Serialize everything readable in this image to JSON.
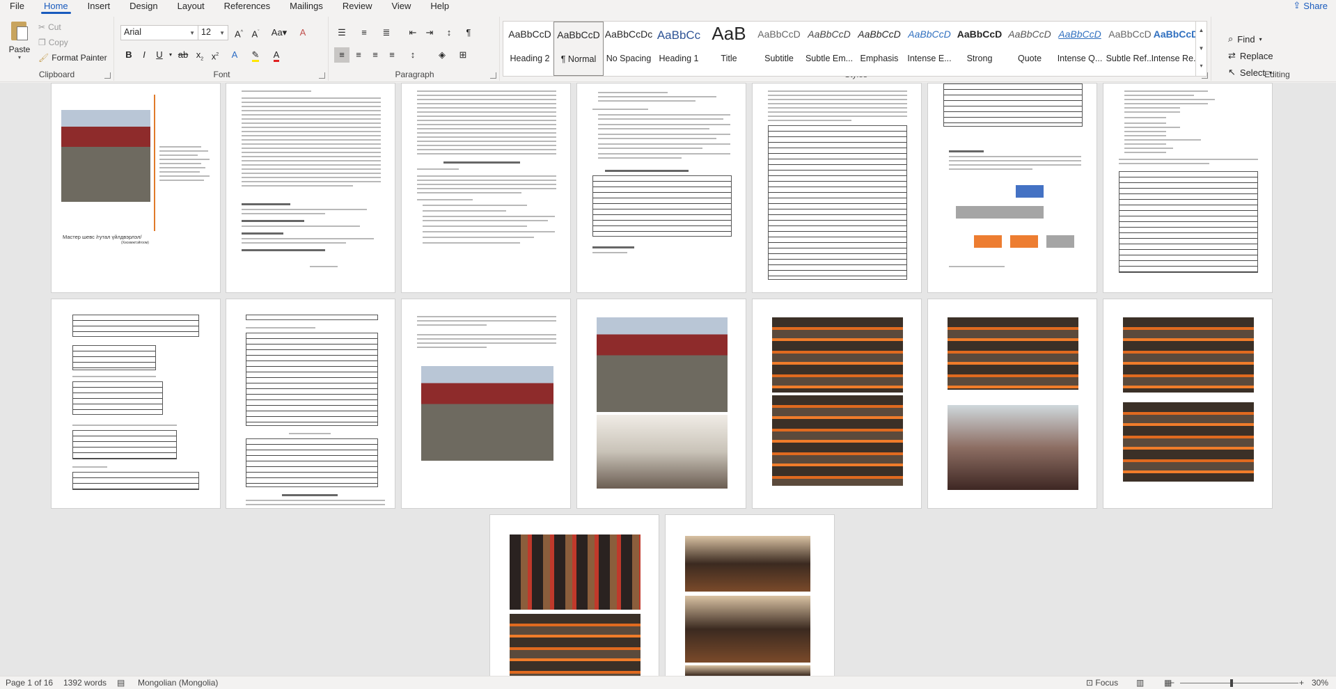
{
  "menu": {
    "tabs": [
      "File",
      "Home",
      "Insert",
      "Design",
      "Layout",
      "References",
      "Mailings",
      "Review",
      "View",
      "Help"
    ],
    "active": "Home",
    "share_label": "Share"
  },
  "clipboard": {
    "paste_label": "Paste",
    "cut_label": "Cut",
    "copy_label": "Copy",
    "format_painter_label": "Format Painter",
    "group_label": "Clipboard"
  },
  "font": {
    "family": "Arial",
    "size": "12",
    "group_label": "Font"
  },
  "paragraph": {
    "group_label": "Paragraph"
  },
  "styles": {
    "group_label": "Styles",
    "items": [
      {
        "sample": "AaBbCcD",
        "name": "Heading 2"
      },
      {
        "sample": "AaBbCcD",
        "name": "¶ Normal"
      },
      {
        "sample": "AaBbCcDc",
        "name": "No Spacing"
      },
      {
        "sample": "AaBbCc",
        "name": "Heading 1"
      },
      {
        "sample": "AaB",
        "name": "Title"
      },
      {
        "sample": "AaBbCcD",
        "name": "Subtitle"
      },
      {
        "sample": "AaBbCcD",
        "name": "Subtle Em..."
      },
      {
        "sample": "AaBbCcD",
        "name": "Emphasis"
      },
      {
        "sample": "AaBbCcD",
        "name": "Intense E..."
      },
      {
        "sample": "AaBbCcD",
        "name": "Strong"
      },
      {
        "sample": "AaBbCcD",
        "name": "Quote"
      },
      {
        "sample": "AaBbCcD",
        "name": "Intense Q..."
      },
      {
        "sample": "AaBbCcD",
        "name": "Subtle Ref..."
      },
      {
        "sample": "AaBbCcD",
        "name": "Intense Re..."
      }
    ],
    "selected_index": 1
  },
  "editing": {
    "group_label": "Editing",
    "find_label": "Find",
    "replace_label": "Replace",
    "select_label": "Select"
  },
  "document": {
    "page1_caption": "Мастер шевс /гутал үйлдвэрлэл/",
    "page1_sub": "(Хөсөмжтэйгоом)"
  },
  "status": {
    "page": "Page 1 of 16",
    "words": "1392 words",
    "language": "Mongolian (Mongolia)",
    "focus_label": "Focus",
    "zoom": "30%"
  },
  "colors": {
    "accent": "#185abd",
    "ribbon_bg": "#f3f2f1",
    "doc_bg": "#e6e6e6"
  }
}
